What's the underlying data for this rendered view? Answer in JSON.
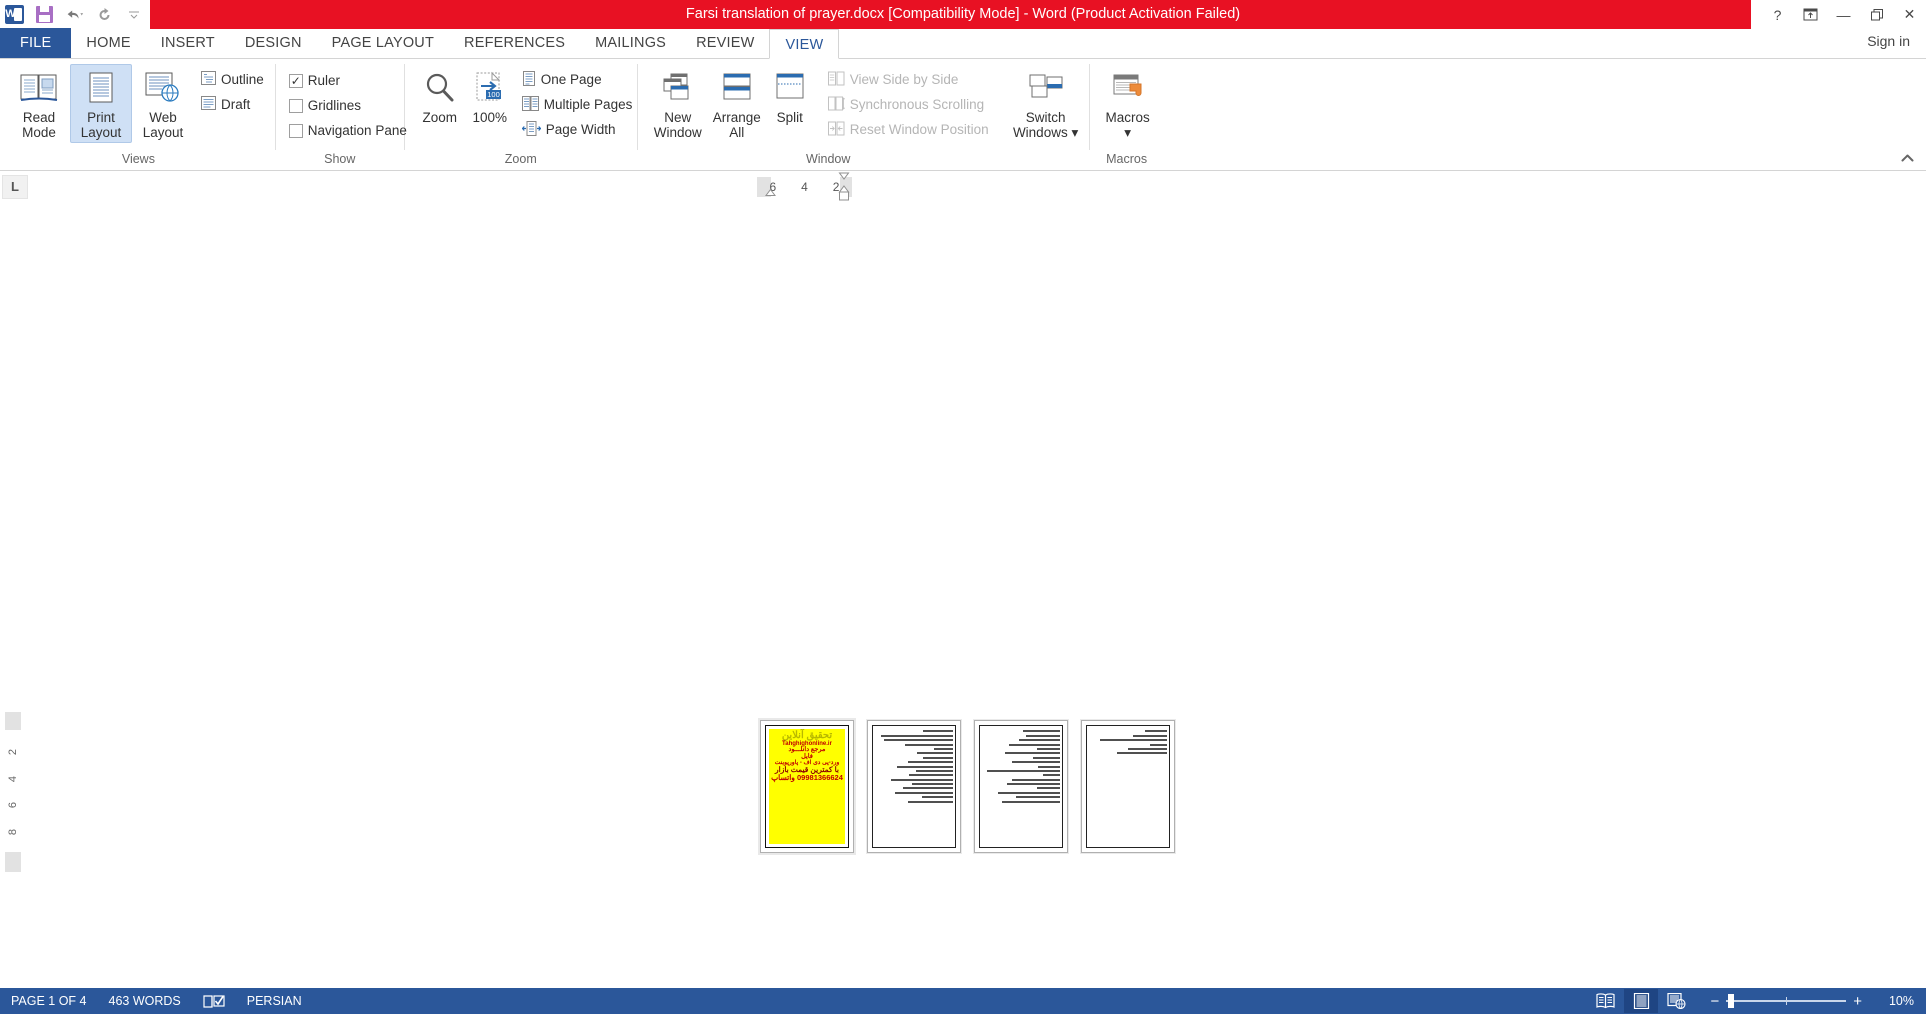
{
  "titlebar": {
    "document_title": "Farsi translation of prayer.docx [Compatibility Mode]  -  Word (Product Activation Failed)",
    "word_letter": "W",
    "quick_access": [
      {
        "name": "save",
        "label": "Save"
      },
      {
        "name": "undo",
        "label": "Undo"
      },
      {
        "name": "redo",
        "label": "Repeat"
      },
      {
        "name": "customize",
        "label": "Customize Quick Access Toolbar"
      }
    ],
    "help_glyph": "?",
    "ribbon_display_glyph": "⤒",
    "minimize_glyph": "—",
    "restore_glyph": "❐",
    "close_glyph": "✕",
    "signin": "Sign in",
    "accent_red": "#e81123",
    "accent_blue": "#2b579a"
  },
  "tabs": [
    {
      "label": "FILE",
      "active": false,
      "file": true
    },
    {
      "label": "HOME",
      "active": false
    },
    {
      "label": "INSERT",
      "active": false
    },
    {
      "label": "DESIGN",
      "active": false
    },
    {
      "label": "PAGE LAYOUT",
      "active": false
    },
    {
      "label": "REFERENCES",
      "active": false
    },
    {
      "label": "MAILINGS",
      "active": false
    },
    {
      "label": "REVIEW",
      "active": false
    },
    {
      "label": "VIEW",
      "active": true
    }
  ],
  "ribbon": {
    "collapse_glyph": "⌃",
    "groups": [
      {
        "name": "views",
        "label": "Views",
        "buttons": [
          {
            "label": "Read Mode",
            "selected": false
          },
          {
            "label": "Print Layout",
            "selected": true
          },
          {
            "label": "Web Layout",
            "selected": false
          }
        ],
        "small": [
          {
            "label": "Outline",
            "disabled": false
          },
          {
            "label": "Draft",
            "disabled": false
          }
        ]
      },
      {
        "name": "show",
        "label": "Show",
        "checks": [
          {
            "label": "Ruler",
            "checked": true
          },
          {
            "label": "Gridlines",
            "checked": false
          },
          {
            "label": "Navigation Pane",
            "checked": false
          }
        ]
      },
      {
        "name": "zoom",
        "label": "Zoom",
        "buttons": [
          {
            "label": "Zoom"
          },
          {
            "label": "100%",
            "badge": "100"
          }
        ],
        "small": [
          {
            "label": "One Page"
          },
          {
            "label": "Multiple Pages"
          },
          {
            "label": "Page Width"
          }
        ]
      },
      {
        "name": "window",
        "label": "Window",
        "buttons": [
          {
            "label": "New Window"
          },
          {
            "label": "Arrange All"
          },
          {
            "label": "Split"
          }
        ],
        "small": [
          {
            "label": "View Side by Side",
            "disabled": true
          },
          {
            "label": "Synchronous Scrolling",
            "disabled": true
          },
          {
            "label": "Reset Window Position",
            "disabled": true
          }
        ],
        "extra": [
          {
            "label": "Switch Windows",
            "dropdown": "▾"
          }
        ]
      },
      {
        "name": "macros",
        "label": "Macros",
        "buttons": [
          {
            "label": "Macros",
            "dropdown": "▾"
          }
        ]
      }
    ]
  },
  "ruler": {
    "tab_stop_glyph": "L",
    "horizontal_ticks": [
      "6",
      "4",
      "2"
    ],
    "vertical_ticks": [
      "2",
      "4",
      "6",
      "8"
    ]
  },
  "document": {
    "zoom_percent": "10%",
    "page_count": 4,
    "pages": [
      {
        "index": 1,
        "type": "advertisement",
        "selected": true,
        "background": "#ffff00",
        "lines": [
          "تحقیق آنلاین",
          "Tahghighonline.ir",
          "مرجع دانلـــود",
          "فایل",
          "ورد-پی دی اف - پاورپوینت",
          "با کمترین قیمت بازار",
          "09981366624 واتساپ"
        ]
      },
      {
        "index": 2,
        "type": "text",
        "selected": false,
        "text_line_widths": [
          38,
          92,
          88,
          62,
          25,
          46,
          38,
          58,
          72,
          48,
          56,
          80,
          52,
          64,
          74,
          40,
          58
        ]
      },
      {
        "index": 3,
        "type": "text",
        "selected": false,
        "text_line_widths": [
          48,
          44,
          52,
          66,
          30,
          70,
          34,
          62,
          28,
          94,
          22,
          62,
          68,
          30,
          80,
          56,
          74
        ]
      },
      {
        "index": 4,
        "type": "text",
        "selected": false,
        "text_line_widths": [
          28,
          44,
          86,
          22,
          50,
          64
        ]
      }
    ]
  },
  "statusbar": {
    "page_indicator": "PAGE 1 OF 4",
    "word_count": "463 WORDS",
    "proofing_icon": "proofing-errors-icon",
    "language": "PERSIAN",
    "view_buttons": [
      {
        "name": "read-mode-view",
        "active": false
      },
      {
        "name": "print-layout-view",
        "active": true
      },
      {
        "name": "web-layout-view",
        "active": false
      }
    ],
    "zoom_out_glyph": "−",
    "zoom_in_glyph": "+",
    "zoom_value": "10%"
  }
}
